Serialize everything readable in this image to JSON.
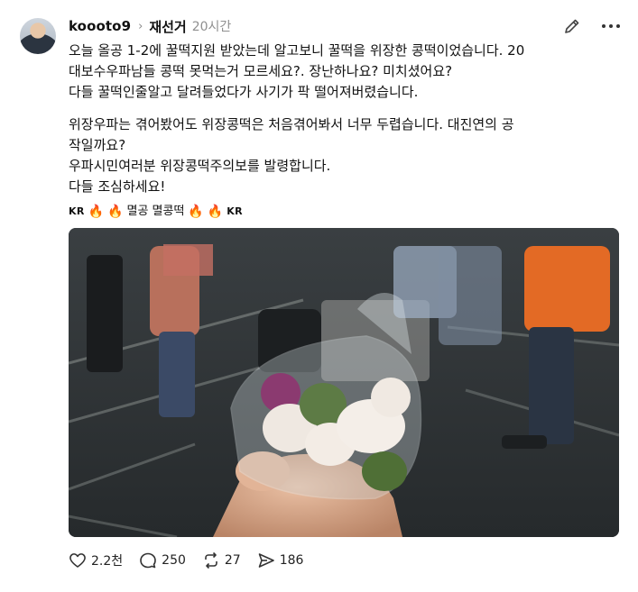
{
  "post": {
    "username": "koooto9",
    "topic": "재선거",
    "time": "20시간",
    "paragraph1": [
      "오늘 올공 1-2에 꿀떡지원 받았는데 알고보니 꿀떡을 위장한 콩떡이었습니다. 20",
      "대보수우파남들 콩떡 못먹는거 모르세요?. 장난하나요? 미치셨어요?",
      "다들 꿀떡인줄알고 달려들었다가 사기가 팍 떨어져버렸습니다."
    ],
    "paragraph2": [
      "위장우파는 겪어봤어도 위장콩떡은 처음겪어봐서 너무 두렵습니다. 대진연의 공",
      "작일까요?",
      "우파시민여러분 위장콩떡주의보를 발령합니다.",
      "다들 조심하세요!"
    ],
    "tags": {
      "kr1": "KR",
      "fire": "🔥",
      "text": "멸공 멸콩떡",
      "kr2": "KR"
    }
  },
  "actions": {
    "like_count": "2.2천",
    "comment_count": "250",
    "repost_count": "27",
    "share_count": "186"
  },
  "icons": [
    "avatar",
    "chevron-right-icon",
    "edit-icon",
    "more-icon",
    "heart-icon",
    "comment-icon",
    "repost-icon",
    "share-icon"
  ]
}
